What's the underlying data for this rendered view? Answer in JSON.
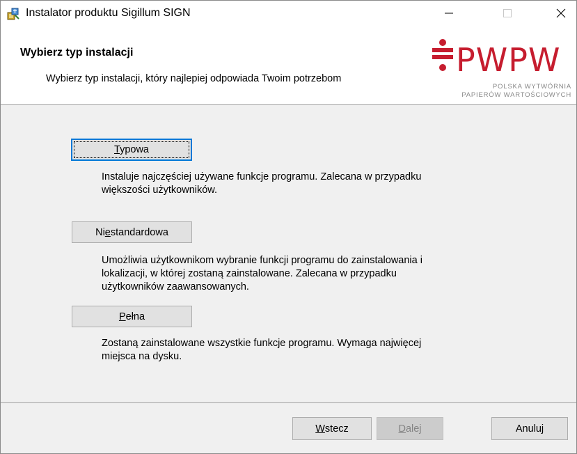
{
  "window": {
    "title": "Instalator produktu Sigillum SIGN"
  },
  "header": {
    "title": "Wybierz typ instalacji",
    "subtitle": "Wybierz typ instalacji, który najlepiej odpowiada Twoim potrzebom",
    "logo": {
      "wordmark": "PWPW",
      "line1": "POLSKA WYTWÓRNIA",
      "line2": "PAPIERÓW WARTOŚCIOWYCH",
      "color": "#c61d2f"
    }
  },
  "options": [
    {
      "label_pre": "",
      "label_key": "T",
      "label_post": "ypowa",
      "description_lines": [
        "Instaluje najczęściej używane funkcje programu. Zalecana w przypadku",
        "większości użytkowników."
      ]
    },
    {
      "label_pre": "Ni",
      "label_key": "e",
      "label_post": "standardowa",
      "description_lines": [
        "Umożliwia użytkownikom wybranie funkcji programu do zainstalowania i",
        "lokalizacji, w której zostaną zainstalowane. Zalecana w przypadku",
        "użytkowników zaawansowanych."
      ]
    },
    {
      "label_pre": "",
      "label_key": "P",
      "label_post": "ełna",
      "description_lines": [
        "Zostaną zainstalowane wszystkie funkcje programu. Wymaga najwięcej",
        "miejsca na dysku."
      ]
    }
  ],
  "footer": {
    "back": {
      "key": "W",
      "rest": "stecz"
    },
    "next": {
      "key": "D",
      "rest": "alej"
    },
    "cancel": {
      "label": "Anuluj"
    }
  },
  "colors": {
    "accent": "#0078d7",
    "brand_red": "#c61d2f"
  },
  "icons": [
    "installer-icon",
    "minimize-icon",
    "maximize-icon",
    "close-icon"
  ]
}
